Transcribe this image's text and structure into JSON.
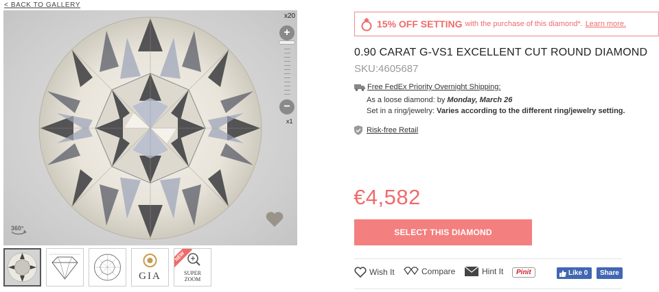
{
  "nav": {
    "back_label": "< BACK TO GALLERY"
  },
  "viewer": {
    "zoom_max_label": "x20",
    "zoom_min_label": "x1",
    "zoom_in_symbol": "+",
    "zoom_out_symbol": "−",
    "rotate_label": "360°"
  },
  "thumbnails": {
    "gia_label": "GIA",
    "super_zoom_label_1": "SUPER",
    "super_zoom_label_2": "ZOOM",
    "new_badge": "NEW"
  },
  "promo": {
    "main": "15% OFF SETTING",
    "rest": "with the purchase of this diamond*.",
    "link": "Learn more."
  },
  "product": {
    "title": "0.90 CARAT G-VS1 EXCELLENT CUT ROUND DIAMOND",
    "sku": "SKU:4605687",
    "price": "€4,582"
  },
  "shipping": {
    "link": "Free FedEx Priority Overnight Shipping:",
    "loose_prefix": "As a loose diamond: by ",
    "loose_date": "Monday, March 26",
    "ring_prefix": "Set in a ring/jewelry: ",
    "ring_value": "Varies according to the different ring/jewelry setting."
  },
  "risk": {
    "link": "Risk-free Retail"
  },
  "cta": {
    "select_label": "SELECT THIS DIAMOND"
  },
  "actions": {
    "wish": "Wish It",
    "compare": "Compare",
    "hint": "Hint It",
    "pinit": "Pinit",
    "fb_like": "Like 0",
    "fb_share": "Share"
  },
  "colors": {
    "accent": "#ef6b6b",
    "button": "#f47f7f",
    "facebook": "#4267b2"
  }
}
